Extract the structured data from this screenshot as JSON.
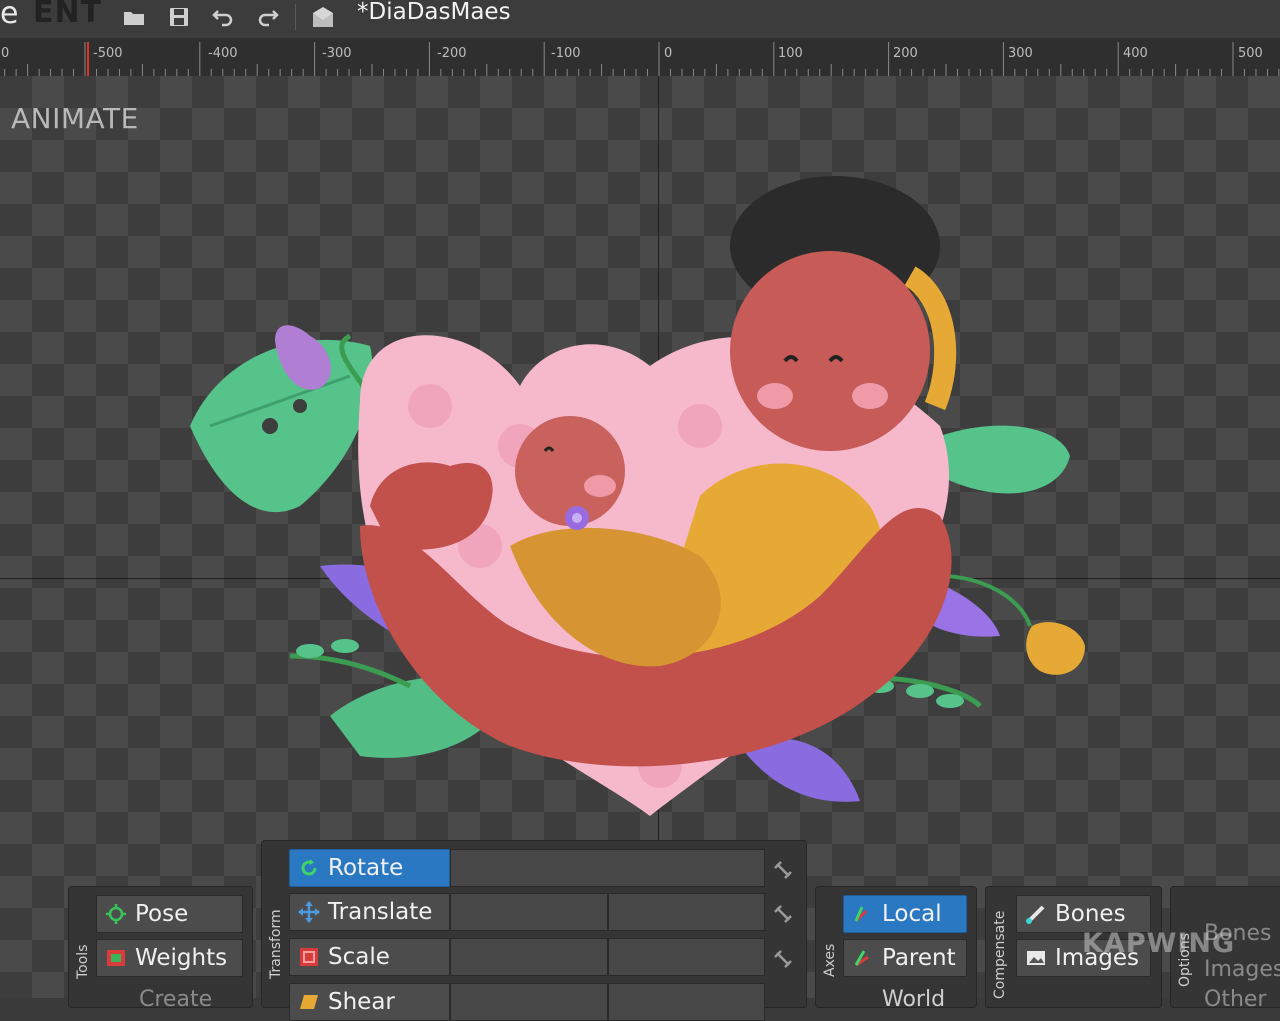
{
  "app": {
    "title_fragment": "e",
    "mode_button": "ENT"
  },
  "document": {
    "title": "*DiaDasMaes"
  },
  "ruler": {
    "labels": [
      "0",
      "-500",
      "-400",
      "-300",
      "-200",
      "-100",
      "0",
      "100",
      "200",
      "300",
      "400",
      "500"
    ]
  },
  "canvas": {
    "mode_label": "ANIMATE"
  },
  "tools": {
    "section_label": "Tools",
    "pose": "Pose",
    "weights": "Weights",
    "create_partial": "Create"
  },
  "transform": {
    "section_label": "Transform",
    "rotate": "Rotate",
    "translate": "Translate",
    "scale": "Scale",
    "shear_partial": "Shear"
  },
  "axes": {
    "section_label": "Axes",
    "local": "Local",
    "parent": "Parent",
    "world_partial": "World"
  },
  "compensate": {
    "section_label": "Compensate",
    "bones": "Bones",
    "images": "Images"
  },
  "options": {
    "section_label": "Options",
    "bones": "Bones",
    "images": "Images",
    "other_partial": "Other"
  },
  "watermark": "KAPWING",
  "colors": {
    "active": "#2a78c2",
    "background": "#3a3a3a",
    "panel": "#353535"
  }
}
